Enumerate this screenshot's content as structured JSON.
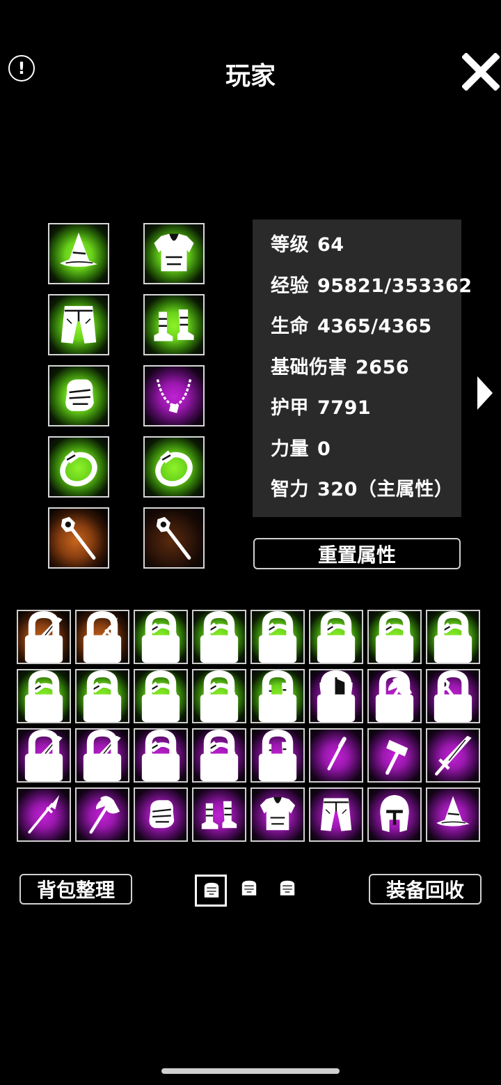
{
  "header": {
    "title": "玩家",
    "info_label": "!"
  },
  "colors": {
    "green": "#7fe51d",
    "purple": "#b21ec4",
    "orange": "#c8651e",
    "white_rare": "#e0e0e0",
    "panel": "#2a2a2a"
  },
  "equipment": [
    {
      "slot": "head",
      "icon": "hat-icon",
      "rarity": "green"
    },
    {
      "slot": "body",
      "icon": "armor-icon",
      "rarity": "green"
    },
    {
      "slot": "legs",
      "icon": "pants-icon",
      "rarity": "green"
    },
    {
      "slot": "feet",
      "icon": "boots-icon",
      "rarity": "green"
    },
    {
      "slot": "hands",
      "icon": "glove-icon",
      "rarity": "green"
    },
    {
      "slot": "neck",
      "icon": "necklace-icon",
      "rarity": "purple"
    },
    {
      "slot": "ring1",
      "icon": "ring-icon",
      "rarity": "green"
    },
    {
      "slot": "ring2",
      "icon": "ring-icon",
      "rarity": "green"
    },
    {
      "slot": "weapon",
      "icon": "staff-icon",
      "rarity": "orange"
    },
    {
      "slot": "offhand",
      "icon": "staff-icon",
      "rarity": "orange-dim"
    }
  ],
  "stats": [
    {
      "label": "等级",
      "value": "64"
    },
    {
      "label": "经验",
      "value": "95821/353362"
    },
    {
      "label": "生命",
      "value": "4365/4365"
    },
    {
      "label": "基础伤害",
      "value": "2656"
    },
    {
      "label": "护甲",
      "value": "7791"
    },
    {
      "label": "力量",
      "value": "0"
    },
    {
      "label": "智力",
      "value": "320（主属性）"
    }
  ],
  "reset_label": "重置属性",
  "inventory": [
    {
      "icon": "sword-icon",
      "rarity": "orange",
      "locked": true
    },
    {
      "icon": "spear-icon",
      "rarity": "orange",
      "locked": true
    },
    {
      "icon": "ring-icon",
      "rarity": "green",
      "locked": true
    },
    {
      "icon": "ring-icon",
      "rarity": "green",
      "locked": true
    },
    {
      "icon": "ring-icon",
      "rarity": "green",
      "locked": true
    },
    {
      "icon": "ring-icon",
      "rarity": "green",
      "locked": true
    },
    {
      "icon": "ring-icon",
      "rarity": "green",
      "locked": true
    },
    {
      "icon": "ring-icon",
      "rarity": "green",
      "locked": true
    },
    {
      "icon": "ring-icon",
      "rarity": "green",
      "locked": true
    },
    {
      "icon": "ring-icon",
      "rarity": "green",
      "locked": true
    },
    {
      "icon": "ring-icon",
      "rarity": "green",
      "locked": true
    },
    {
      "icon": "ring-icon",
      "rarity": "green",
      "locked": true
    },
    {
      "icon": "boots-icon",
      "rarity": "green",
      "locked": true
    },
    {
      "icon": "shield-icon",
      "rarity": "purple",
      "locked": true
    },
    {
      "icon": "axe-icon",
      "rarity": "purple",
      "locked": true
    },
    {
      "icon": "staff-icon",
      "rarity": "purple",
      "locked": true
    },
    {
      "icon": "sword-icon",
      "rarity": "purple",
      "locked": true
    },
    {
      "icon": "sword-icon",
      "rarity": "purple",
      "locked": true
    },
    {
      "icon": "ring-icon",
      "rarity": "purple",
      "locked": true
    },
    {
      "icon": "ring-icon",
      "rarity": "purple",
      "locked": true
    },
    {
      "icon": "boots-icon",
      "rarity": "purple",
      "locked": true
    },
    {
      "icon": "dagger-icon",
      "rarity": "purple",
      "locked": false
    },
    {
      "icon": "hammer-icon",
      "rarity": "purple",
      "locked": false
    },
    {
      "icon": "sword-icon",
      "rarity": "purple",
      "locked": false
    },
    {
      "icon": "spear-icon",
      "rarity": "purple",
      "locked": false
    },
    {
      "icon": "axe-icon",
      "rarity": "purple",
      "locked": false
    },
    {
      "icon": "glove-icon",
      "rarity": "purple",
      "locked": false
    },
    {
      "icon": "boots-icon",
      "rarity": "purple",
      "locked": false
    },
    {
      "icon": "armor-icon",
      "rarity": "purple",
      "locked": false
    },
    {
      "icon": "pants-icon",
      "rarity": "purple",
      "locked": false
    },
    {
      "icon": "helmet-icon",
      "rarity": "purple",
      "locked": false
    },
    {
      "icon": "hat-icon",
      "rarity": "purple",
      "locked": false
    }
  ],
  "footer": {
    "sort_label": "背包整理",
    "recycle_label": "装备回收",
    "pages": [
      {
        "icon": "backpack-icon",
        "selected": true
      },
      {
        "icon": "backpack-icon",
        "selected": false
      },
      {
        "icon": "backpack-icon",
        "selected": false
      }
    ]
  }
}
